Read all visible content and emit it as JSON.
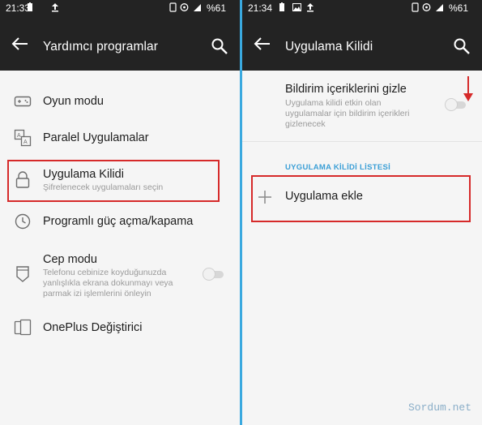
{
  "left": {
    "status": {
      "time": "21:33",
      "battery": "%61"
    },
    "header": {
      "title": "Yardımcı programlar"
    },
    "items": [
      {
        "label": "Oyun modu"
      },
      {
        "label": "Paralel Uygulamalar"
      },
      {
        "label": "Uygulama Kilidi",
        "sub": "Şifrelenecek uygulamaları seçin"
      },
      {
        "label": "Programlı güç açma/kapama"
      },
      {
        "label": "Cep modu",
        "sub1": "Telefonu cebinize koyduğunuzda",
        "sub2": "yanlışlıkla ekrana dokunmayı veya",
        "sub3": "parmak izi işlemlerini önleyin"
      },
      {
        "label": "OnePlus Değiştirici"
      }
    ]
  },
  "right": {
    "status": {
      "time": "21:34",
      "battery": "%61"
    },
    "header": {
      "title": "Uygulama Kilidi"
    },
    "notif": {
      "label": "Bildirim içeriklerini gizle",
      "sub1": "Uygulama kilidi etkin olan",
      "sub2": "uygulamalar için bildirim içerikleri",
      "sub3": "gizlenecek"
    },
    "section": "UYGULAMA KİLİDİ LİSTESİ",
    "add": {
      "label": "Uygulama ekle"
    }
  },
  "watermark": "Sordum.net",
  "colors": {
    "appbar": "#232323",
    "accent": "#3b9fd6",
    "highlight": "#d62a2a"
  }
}
